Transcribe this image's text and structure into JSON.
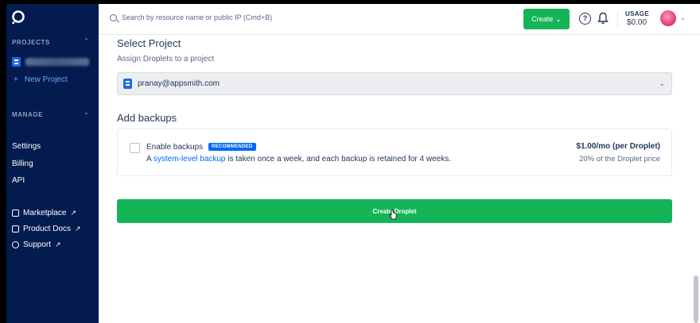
{
  "sidebar": {
    "projects_heading": "PROJECTS",
    "new_project": "New Project",
    "manage_heading": "MANAGE",
    "links": [
      "Settings",
      "Billing",
      "API"
    ],
    "external": [
      {
        "label": "Marketplace",
        "icon": "cube-icon"
      },
      {
        "label": "Product Docs",
        "icon": "layers-icon"
      },
      {
        "label": "Support",
        "icon": "lifebuoy-icon"
      }
    ]
  },
  "header": {
    "search_placeholder": "Search by resource name or public IP (Cmd+B)",
    "create_label": "Create",
    "usage_label": "USAGE",
    "usage_value": "$0.00"
  },
  "main": {
    "select_project_title": "Select Project",
    "select_project_sub": "Assign Droplets to a project",
    "selected_project": "pranay@appsmith.com",
    "backups_title": "Add backups",
    "enable_backups": "Enable backups",
    "badge": "RECOMMENDED",
    "desc_pre": "A ",
    "desc_link": "system-level backup",
    "desc_post": " is taken once a week, and each backup is retained for 4 weeks.",
    "price": "$1.00/mo (per Droplet)",
    "price_sub": "20% of the Droplet price",
    "create_droplet": "Create Droplet"
  },
  "colors": {
    "sidebar_bg": "#031b4e",
    "accent_green": "#15b557",
    "link_blue": "#0069ff"
  }
}
